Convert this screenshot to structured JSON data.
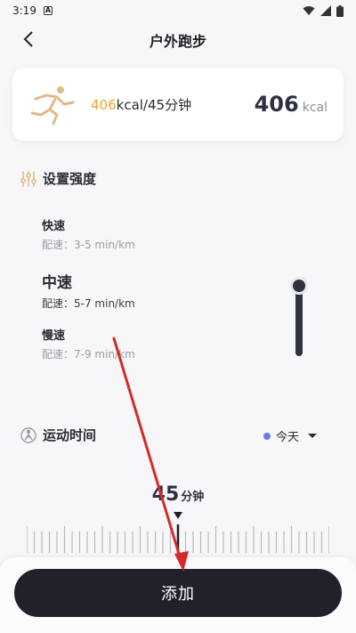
{
  "status_bar": {
    "time": "3:19"
  },
  "header": {
    "title": "户外跑步"
  },
  "summary": {
    "kcal_highlight": "406",
    "detail_rest": "kcal/45分钟",
    "big_value": "406",
    "unit": "kcal"
  },
  "intensity": {
    "title": "设置强度",
    "options": [
      {
        "name": "快速",
        "pace": "配速：3-5 min/km"
      },
      {
        "name": "中速",
        "pace": "配速：5-7 min/km"
      },
      {
        "name": "慢速",
        "pace": "配速：7-9 min/km"
      }
    ],
    "selected_index": 1
  },
  "exercise_time": {
    "title": "运动时间",
    "date_label": "今天",
    "value": "45",
    "unit": "分钟"
  },
  "actions": {
    "add_label": "添加"
  },
  "colors": {
    "accent_orange": "#f0a32a",
    "dark": "#22202b",
    "dot_blue": "#6a7be6",
    "annotation_red": "#d42a2a"
  }
}
